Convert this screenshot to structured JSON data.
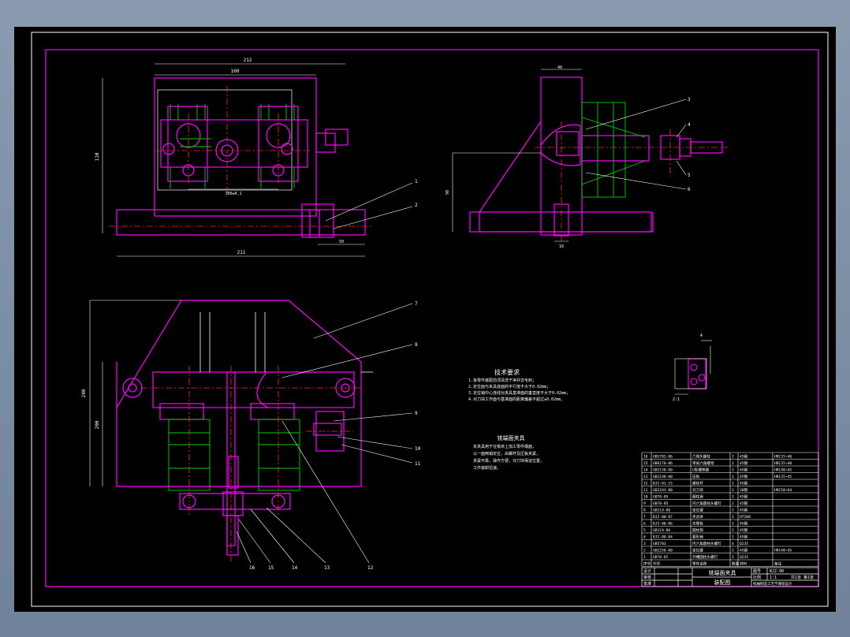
{
  "drawing": {
    "top_view": {
      "dim_width": "212",
      "dim_inner": "160",
      "dim_height": "110",
      "dim_base": "211",
      "dim_pin_spacing": "100±0.1",
      "dim_side": "50",
      "callouts": [
        "1",
        "2"
      ]
    },
    "side_view": {
      "dim_top": "40",
      "dim_height": "90",
      "dim_bottom": "16",
      "callouts": [
        "3",
        "4",
        "5",
        "6"
      ]
    },
    "front_view": {
      "dim_height_outer": "240",
      "dim_height_inner": "200",
      "callouts_right": [
        "7",
        "8",
        "9",
        "10",
        "11"
      ],
      "callouts_bottom": [
        "16",
        "15",
        "14",
        "13",
        "12"
      ]
    },
    "detail": {
      "label": "A",
      "scale": "2:1"
    },
    "technical_requirements": {
      "title": "技术要求",
      "items": [
        "1.各零件装配前须清洗干净并去毛刺；",
        "2.定位面与夹具底面的平行度不大于0.02mm；",
        "3.定位销中心连线对夹具基准面的垂直度不大于0.02mm；",
        "4.对刀块工作面与基准面的距离偏差不超过±0.02mm。"
      ]
    },
    "fixture_description": {
      "title": "铣端面夹具",
      "lines": [
        "本夹具用于在铣床上加工零件端面，",
        "以一面两销定位，由螺杆及压板夹紧，",
        "夹紧可靠，操作方便，对刀块保证位置，",
        "工件装卸迅速。"
      ]
    }
  },
  "parts_list": {
    "rows": [
      {
        "no": "16",
        "code": "GB5782-86",
        "name": "六角头螺栓",
        "qty": "2",
        "material": "45钢",
        "note": "HRC35~40"
      },
      {
        "no": "15",
        "code": "GB6170-86",
        "name": "带肩六角螺母",
        "qty": "1",
        "material": "45钢",
        "note": "HRC35~40"
      },
      {
        "no": "14",
        "code": "GB2150-80",
        "name": "U型槽垫圈",
        "qty": "1",
        "material": "45钢",
        "note": "HRC40~45"
      },
      {
        "no": "13",
        "code": "GB2148-80",
        "name": "压板",
        "qty": "1",
        "material": "45钢",
        "note": "HRC35~45"
      },
      {
        "no": "12",
        "code": "BJZ-01-15",
        "name": "螺栓杆",
        "qty": "1",
        "material": "45钢",
        "note": ""
      },
      {
        "no": "11",
        "code": "GB2243-80",
        "name": "对刀块",
        "qty": "1",
        "material": "20钢",
        "note": "HRC58~64"
      },
      {
        "no": "10",
        "code": "GB70-85",
        "name": "圆柱销",
        "qty": "2",
        "material": "45钢",
        "note": ""
      },
      {
        "no": "9",
        "code": "GB70-85",
        "name": "内六角圆柱头螺钉",
        "qty": "2",
        "material": "45钢",
        "note": ""
      },
      {
        "no": "8",
        "code": "GB119-86",
        "name": "定位键",
        "qty": "2",
        "material": "45钢",
        "note": ""
      },
      {
        "no": "7",
        "code": "BJZ-00-07",
        "name": "夹具体",
        "qty": "1",
        "material": "HT200",
        "note": ""
      },
      {
        "no": "6",
        "code": "BJZ-00-06",
        "name": "支撑板",
        "qty": "1",
        "material": "45钢",
        "note": ""
      },
      {
        "no": "5",
        "code": "GB119-86",
        "name": "圆柱销",
        "qty": "1",
        "material": "45钢",
        "note": ""
      },
      {
        "no": "4",
        "code": "BJZ-00-04",
        "name": "菱形销",
        "qty": "1",
        "material": "45钢",
        "note": ""
      },
      {
        "no": "3",
        "code": "GB5783",
        "name": "内六角圆柱头螺钉",
        "qty": "4",
        "material": "Q235",
        "note": ""
      },
      {
        "no": "2",
        "code": "GB2258-80",
        "name": "定位键",
        "qty": "2",
        "material": "45钢",
        "note": "HRC40~45"
      },
      {
        "no": "1",
        "code": "GB70-85",
        "name": "开槽圆柱头螺钉",
        "qty": "2",
        "material": "Q235",
        "note": ""
      }
    ],
    "header": {
      "no": "序号",
      "code": "代号",
      "name": "零件名称",
      "qty": "数量",
      "material": "材料",
      "note": "备注"
    }
  },
  "title_block": {
    "drawing_name": "铣端面夹具",
    "drawing_type": "装配图",
    "drawing_no": "BJZ-00",
    "scale": "1:1",
    "sheet": "共1张 第1张",
    "label_design": "设计",
    "label_check": "审核",
    "label_approve": "批准",
    "label_scale": "比例",
    "label_drawing_no": "图号",
    "label_weight": "重量",
    "school": "机械制造工艺学课程设计"
  },
  "colors": {
    "outline": "#ff00ff",
    "frame": "#ff00ff",
    "inner_line": "#ffffff",
    "green_parts": "#00d000",
    "centerline": "#ff2a2a",
    "background": "#000000"
  }
}
